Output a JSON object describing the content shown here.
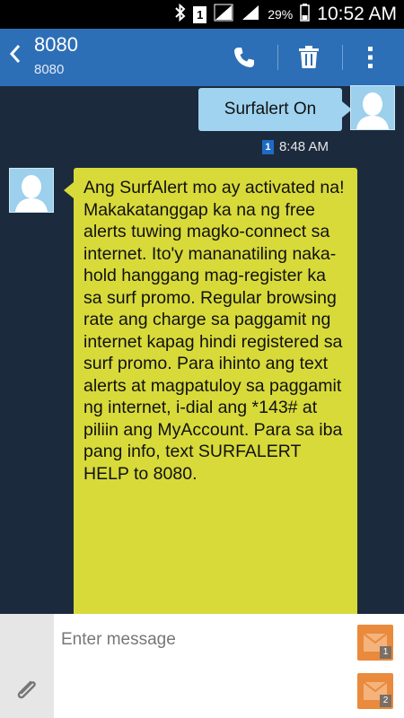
{
  "status_bar": {
    "sim_slot": "1",
    "battery_percent": "29%",
    "time": "10:52 AM"
  },
  "header": {
    "title": "8080",
    "subtitle": "8080"
  },
  "conversation": {
    "outgoing": {
      "text": "Surfalert On",
      "sim_slot": "1",
      "time": "8:48 AM"
    },
    "incoming": {
      "text": "Ang SurfAlert mo ay activated na! Makakatanggap ka na ng free alerts tuwing magko-connect sa internet. Ito'y mananatiling naka-hold hanggang mag-register ka sa surf promo. Regular browsing rate ang charge sa paggamit ng internet kapag hindi registered sa surf promo. Para ihinto ang text alerts at magpatuloy sa paggamit ng internet, i-dial ang *143# at piliin ang MyAccount. Para sa iba pang info, text SURFALERT HELP to 8080."
    }
  },
  "composer": {
    "placeholder": "Enter message",
    "send_sim1_badge": "1",
    "send_sim2_badge": "2"
  },
  "colors": {
    "header": "#2d6fb6",
    "background": "#1c2a3d",
    "incoming_bubble": "#d8da3a",
    "outgoing_bubble": "#9fd3ef",
    "send_button": "#e98a3c"
  }
}
